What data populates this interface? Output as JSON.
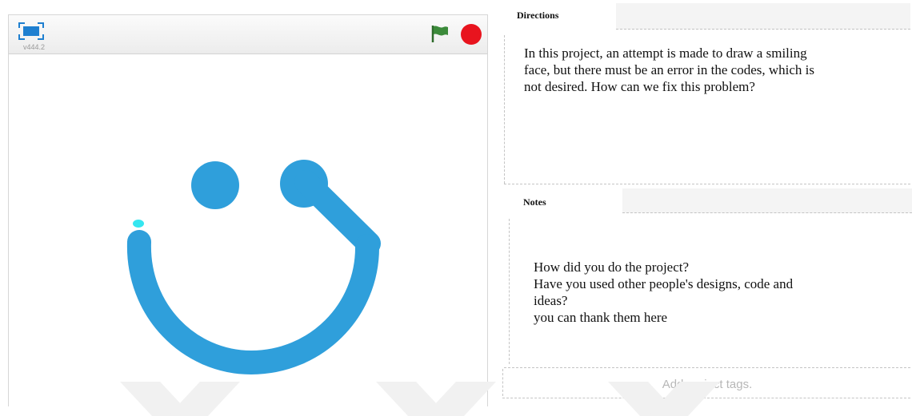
{
  "stage": {
    "version": "v444.2",
    "controls": {
      "fullscreen_icon": "fullscreen-icon",
      "green_flag_icon": "green-flag-icon",
      "stop_icon": "stop-icon"
    },
    "drawing": {
      "description_colors": {
        "pen": "#2f9fdb",
        "sprite_cursor": "#35e6f0"
      }
    }
  },
  "directions": {
    "title": "Directions",
    "text": "In this project, an attempt is made to draw a smiling\nface, but there must be an error in the codes, which is\nnot desired. How can we fix this problem?"
  },
  "notes": {
    "title": "Notes",
    "text": "How did you do the project?\nHave you used other people's designs, code and\nideas?\nyou can thank them here"
  },
  "tags": {
    "placeholder": "Add project tags."
  },
  "colors": {
    "accent_red": "#e8141e",
    "flag_green": "#3b8a3a",
    "icon_blue": "#1e7fd0"
  }
}
